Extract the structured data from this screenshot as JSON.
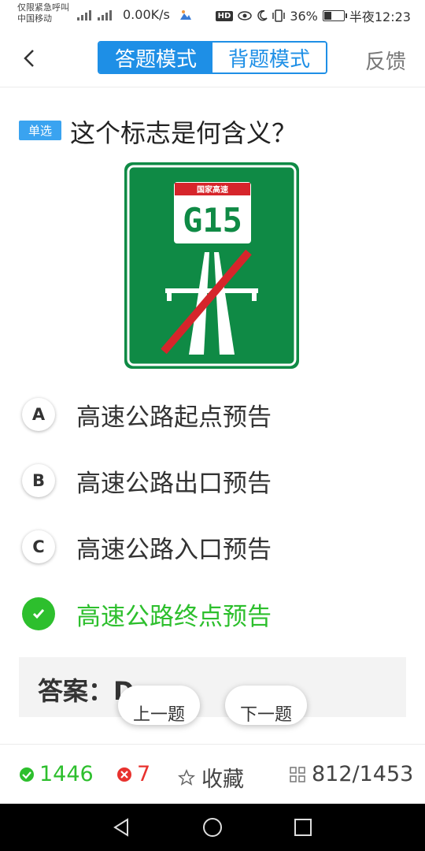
{
  "status_bar": {
    "carrier_line1": "仅限紧急呼叫",
    "carrier_line2": "中国移动",
    "net_speed": "0.00K/s",
    "hd_badge": "HD",
    "battery_percent": "36%",
    "battery_level": 0.36,
    "time": "半夜12:23"
  },
  "header": {
    "tabs": [
      {
        "label": "答题模式",
        "active": true
      },
      {
        "label": "背题模式",
        "active": false
      }
    ],
    "feedback_label": "反馈"
  },
  "question": {
    "type_badge": "单选",
    "title": "这个标志是何含义？",
    "sign": {
      "plate_top": "国家高速",
      "route_code": "G15",
      "colors": {
        "green": "#0f8a45",
        "red": "#d6252b"
      }
    }
  },
  "options": [
    {
      "letter": "A",
      "text": "高速公路起点预告",
      "correct": false
    },
    {
      "letter": "B",
      "text": "高速公路出口预告",
      "correct": false
    },
    {
      "letter": "C",
      "text": "高速公路入口预告",
      "correct": false
    },
    {
      "letter": "D",
      "text": "高速公路终点预告",
      "correct": true
    }
  ],
  "answer": {
    "text": "答案：D"
  },
  "nav": {
    "prev_label": "上一题",
    "next_label": "下一题"
  },
  "stats": {
    "correct_count": "1446",
    "wrong_count": "7",
    "favorite_label": "收藏",
    "progress": "812/1453"
  },
  "colors": {
    "accent": "#1e8fe6",
    "correct": "#2dbf2d",
    "wrong": "#e8322e"
  }
}
